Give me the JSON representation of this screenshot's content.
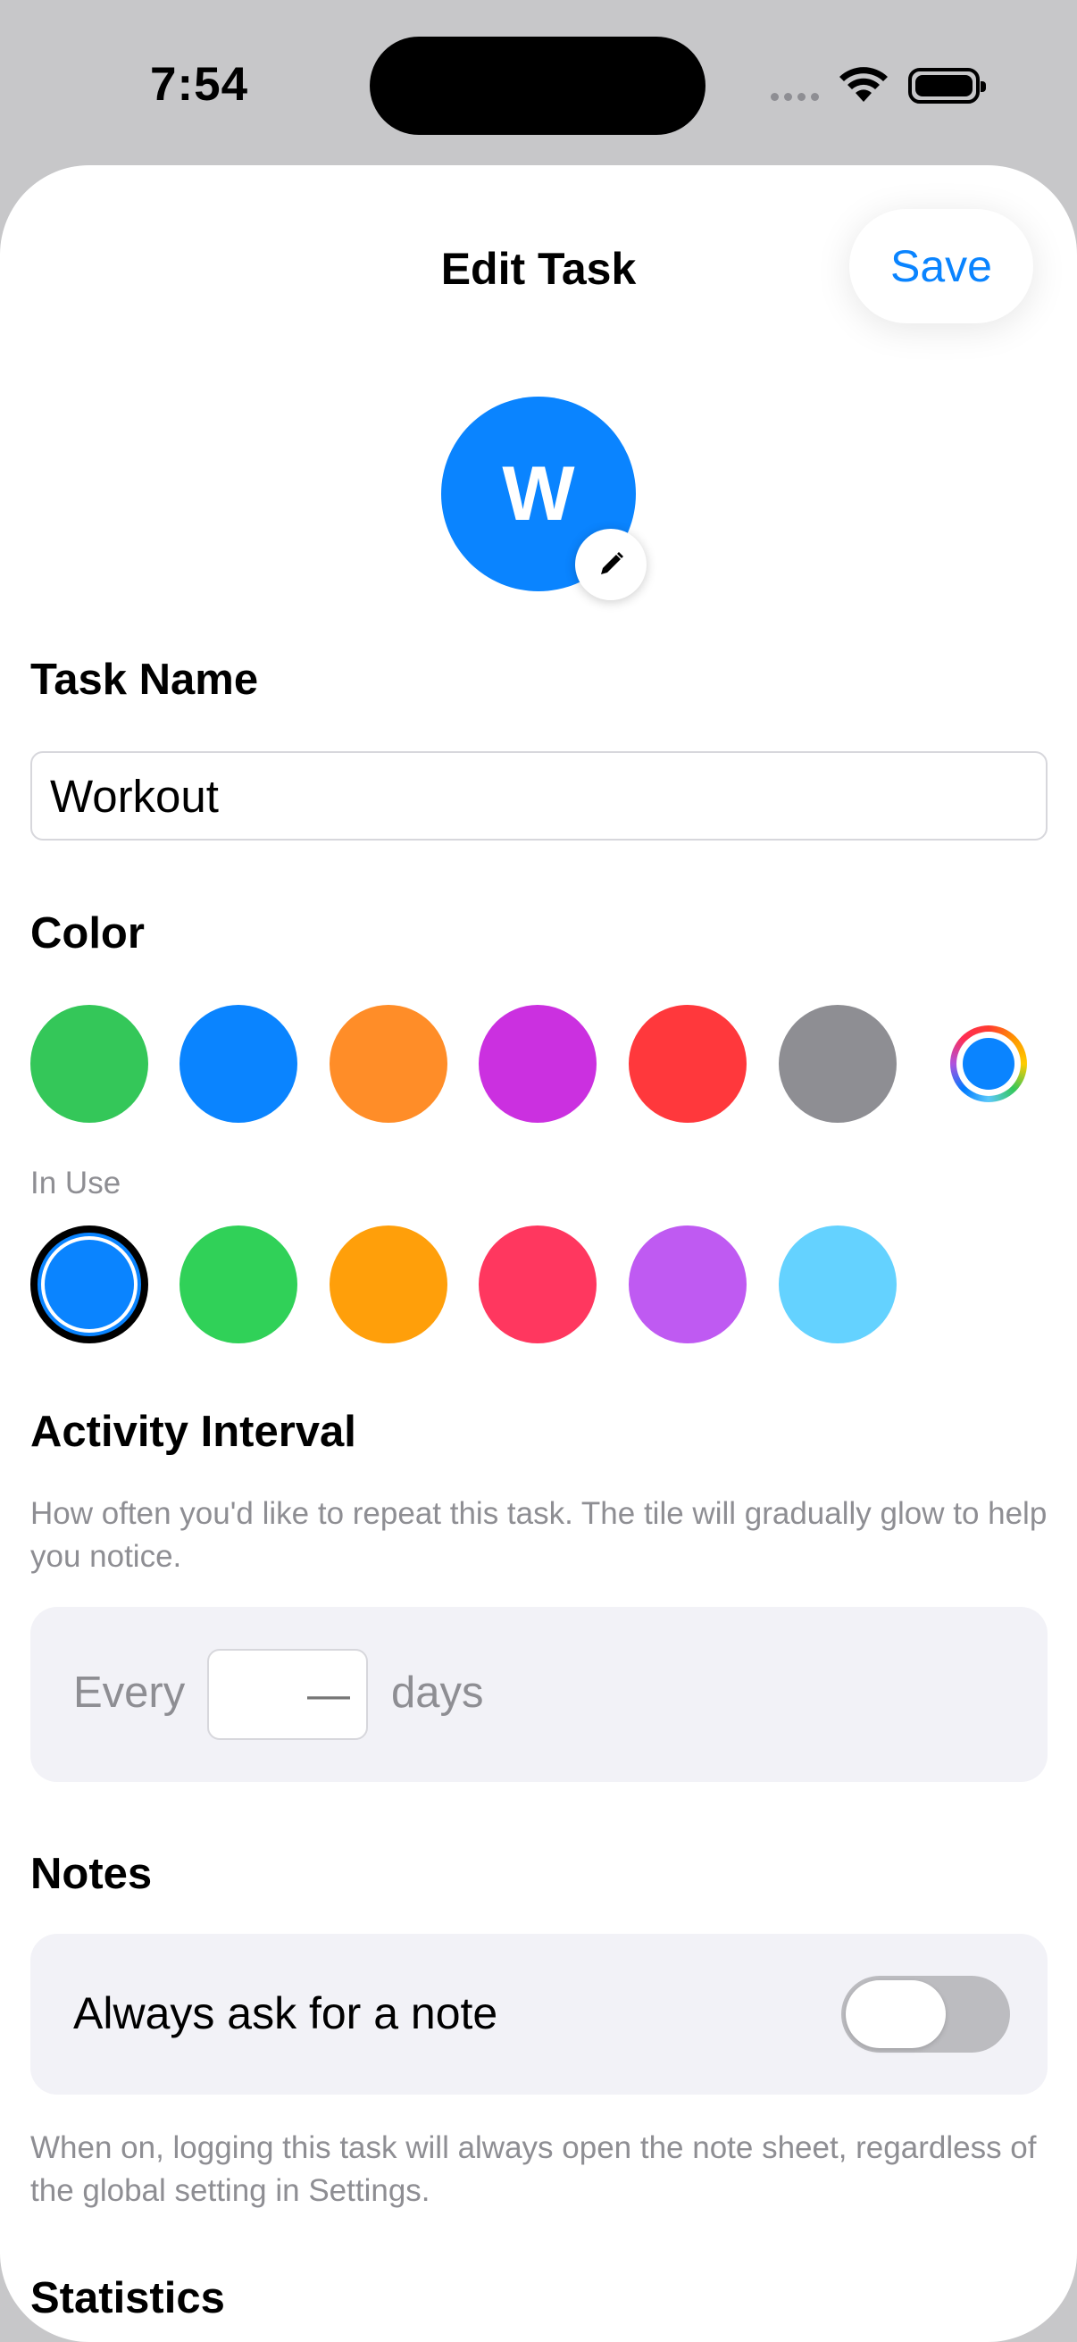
{
  "status": {
    "time": "7:54"
  },
  "header": {
    "title": "Edit Task",
    "save_label": "Save"
  },
  "avatar": {
    "letter": "W"
  },
  "task_name": {
    "label": "Task Name",
    "value": "Workout"
  },
  "color": {
    "label": "Color",
    "palette": [
      "#34c759",
      "#0a84ff",
      "#ff8d28",
      "#cb30e0",
      "#ff383c",
      "#8e8e93"
    ],
    "in_use_label": "In Use",
    "in_use": [
      "#0a84ff",
      "#30d158",
      "#ff9f0a",
      "#ff375f",
      "#bf5af2",
      "#64d2ff"
    ],
    "selected": "#0a84ff"
  },
  "interval": {
    "title": "Activity Interval",
    "help": "How often you'd like to repeat this task. The tile will gradually glow to help you notice.",
    "every_label": "Every",
    "days_placeholder": "—",
    "days_label": "days"
  },
  "notes": {
    "title": "Notes",
    "toggle_label": "Always ask for a note",
    "toggle_on": false,
    "help": "When on, logging this task will always open the note sheet, regardless of the global setting in Settings."
  },
  "statistics": {
    "title": "Statistics"
  }
}
